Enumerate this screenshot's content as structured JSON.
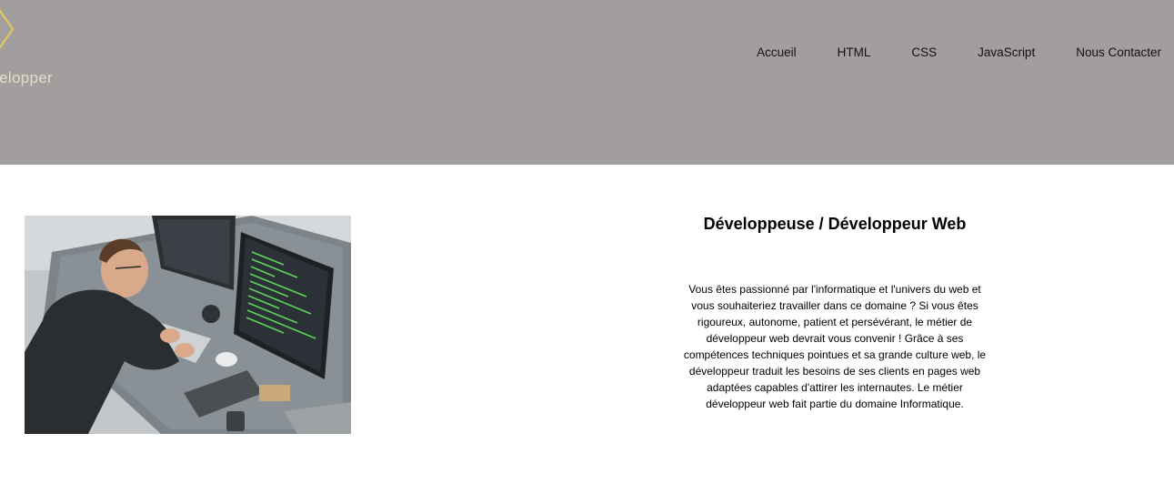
{
  "header": {
    "background": "#a29e9d",
    "logo_text": "Developper",
    "logo_color": "#e0c75a"
  },
  "nav": {
    "items": [
      {
        "label": "Accueil"
      },
      {
        "label": "HTML"
      },
      {
        "label": "CSS"
      },
      {
        "label": "JavaScript"
      },
      {
        "label": "Nous Contacter"
      }
    ]
  },
  "main": {
    "image_icon": "developer-at-desk-photo",
    "title": "Développeuse / Développeur Web",
    "description": "Vous êtes passionné par l'informatique et l'univers du web et vous souhaiteriez travailler dans ce domaine ? Si vous êtes rigoureux, autonome, patient et persévérant, le métier de développeur web devrait vous convenir ! Grâce à ses compétences techniques pointues et sa grande culture web, le développeur traduit les besoins de ses clients en pages web adaptées capables d'attirer les internautes. Le métier développeur web fait partie du domaine Informatique."
  }
}
